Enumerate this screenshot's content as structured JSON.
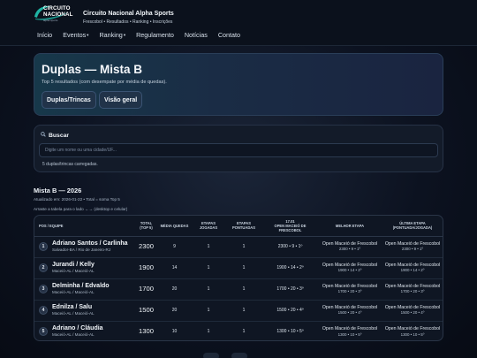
{
  "brand": {
    "logo_line1": "CIRCUITO",
    "logo_line2": "NACIONAL",
    "logo_sub": "alpha sports",
    "title": "Circuito Nacional Alpha Sports",
    "subtitle": "Frescobol • Resultados • Ranking • Inscrições"
  },
  "nav": {
    "items": [
      {
        "label": "Início"
      },
      {
        "label": "Eventos",
        "caret": "▾"
      },
      {
        "label": "Ranking",
        "caret": "▾"
      },
      {
        "label": "Regulamento"
      },
      {
        "label": "Notícias"
      },
      {
        "label": "Contato"
      }
    ]
  },
  "hero": {
    "title": "Duplas — Mista B",
    "description": "Top 5 resultados (com desempate por média de quedas).",
    "button_duplas": "Duplas/Trincas",
    "button_geral": "Visão geral"
  },
  "search": {
    "title": "Buscar",
    "placeholder": "Digite um nome ou uma cidade/UF...",
    "status": "5 duplas/trincas carregadas."
  },
  "results": {
    "title": "Mista B — 2026",
    "meta": "Atualizado em: 2026-01-22 • Total = soma Top 5",
    "hint": "Arraste a tabela para o lado ←→ (desktop e celular)"
  },
  "table": {
    "headers": {
      "pos": "POS / EQUIPE",
      "total": "TOTAL (TOP 5)",
      "media": "MÉDIA QUEDAS",
      "jogadas": "ETAPAS JOGADAS",
      "pontuadas": "ETAPAS PONTUADAS",
      "etapa_line1": "17.01",
      "etapa_line2": "OPEN MACEIÓ DE FRESCOBOL",
      "melhor": "MELHOR ETAPA",
      "ultima": "ÚLTIMA ETAPA (PONTUADA/JOGADA)"
    },
    "rows": [
      {
        "pos": "1",
        "team": "Adriano Santos / Carlinha",
        "city": "Salvador-BA / Rio de Janeiro-RJ",
        "total": "2300",
        "media": "9",
        "jogadas": "1",
        "pontuadas": "1",
        "etapa": "2300 • 9 • 1º",
        "melhor_name": "Open Maceió de Frescobol",
        "melhor_det": "2300 • 9 • 1º",
        "ultima_name": "Open Maceió de Frescobol",
        "ultima_det": "2300 • 9 • 1º"
      },
      {
        "pos": "2",
        "team": "Jurandi / Kelly",
        "city": "Maceió-AL / Maceió-AL",
        "total": "1900",
        "media": "14",
        "jogadas": "1",
        "pontuadas": "1",
        "etapa": "1900 • 14 • 2º",
        "melhor_name": "Open Maceió de Frescobol",
        "melhor_det": "1900 • 14 • 2º",
        "ultima_name": "Open Maceió de Frescobol",
        "ultima_det": "1900 • 14 • 2º"
      },
      {
        "pos": "3",
        "team": "Delminha / Edvaldo",
        "city": "Maceió-AL / Maceió-AL",
        "total": "1700",
        "media": "20",
        "jogadas": "1",
        "pontuadas": "1",
        "etapa": "1700 • 20 • 3º",
        "melhor_name": "Open Maceió de Frescobol",
        "melhor_det": "1700 • 20 • 3º",
        "ultima_name": "Open Maceió de Frescobol",
        "ultima_det": "1700 • 20 • 3º"
      },
      {
        "pos": "4",
        "team": "Ednilza / Salu",
        "city": "Maceió-AL / Maceió-AL",
        "total": "1500",
        "media": "20",
        "jogadas": "1",
        "pontuadas": "1",
        "etapa": "1500 • 20 • 4º",
        "melhor_name": "Open Maceió de Frescobol",
        "melhor_det": "1500 • 20 • 4º",
        "ultima_name": "Open Maceió de Frescobol",
        "ultima_det": "1500 • 20 • 4º"
      },
      {
        "pos": "5",
        "team": "Adriano / Cláudia",
        "city": "Maceió-AL / Maceió-AL",
        "total": "1300",
        "media": "10",
        "jogadas": "1",
        "pontuadas": "1",
        "etapa": "1300 • 10 • 5º",
        "melhor_name": "Open Maceió de Frescobol",
        "melhor_det": "1300 • 10 • 5º",
        "ultima_name": "Open Maceió de Frescobol",
        "ultima_det": "1300 • 10 • 5º"
      }
    ]
  },
  "colors": {
    "background": "#0c1220",
    "hero_accent": "#17384a",
    "logo_accent": "#1fb5a5"
  }
}
